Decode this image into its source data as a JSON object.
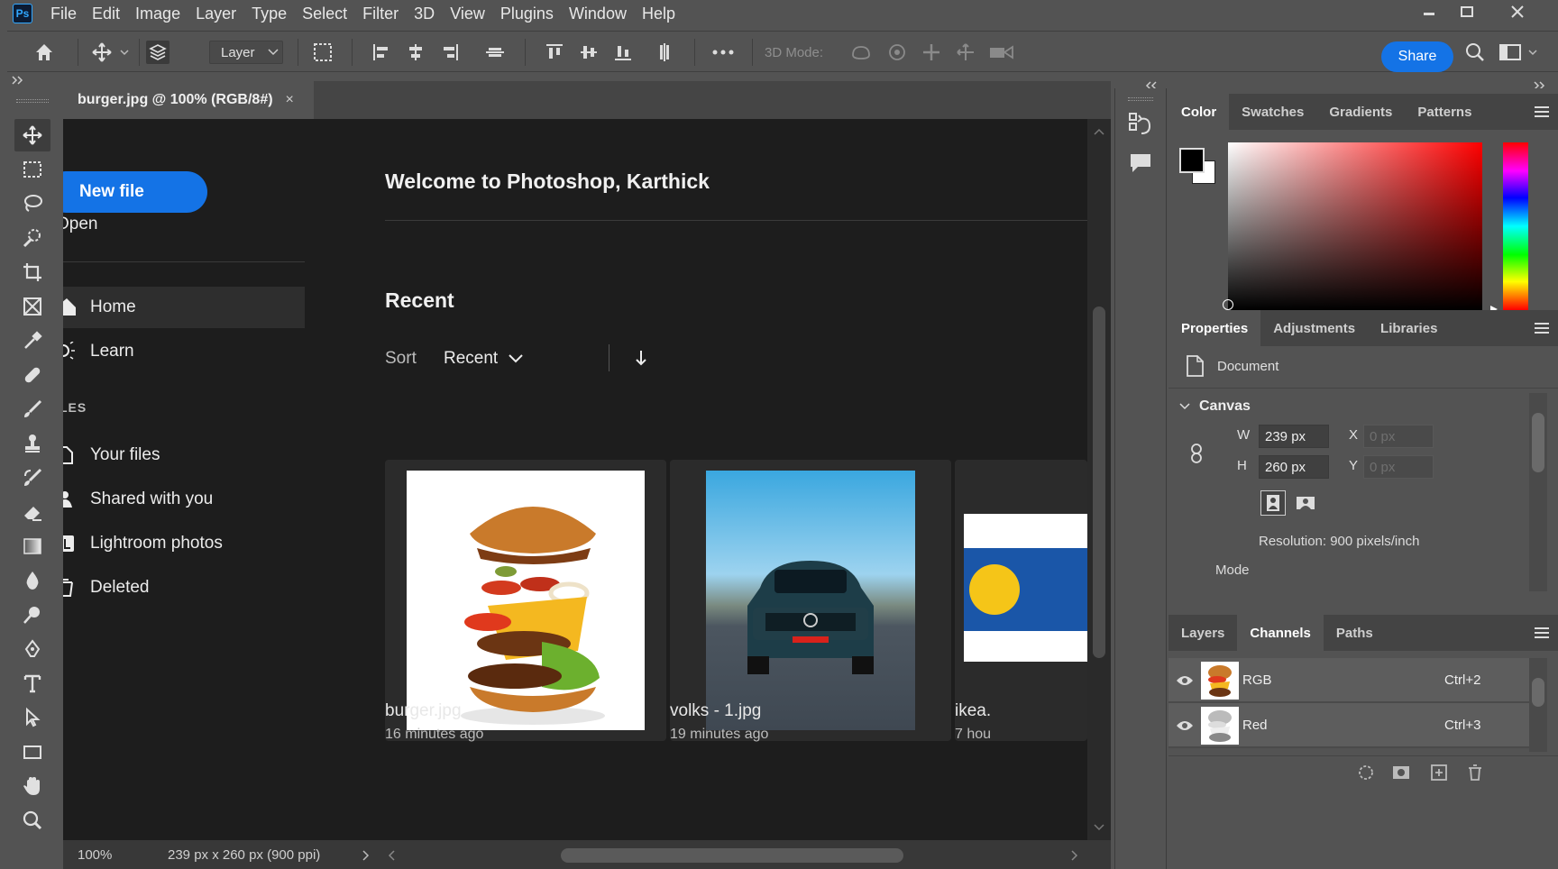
{
  "app": {
    "logo": "Ps"
  },
  "menu": [
    "File",
    "Edit",
    "Image",
    "Layer",
    "Type",
    "Select",
    "Filter",
    "3D",
    "View",
    "Plugins",
    "Window",
    "Help"
  ],
  "options_bar": {
    "layer_select": "Layer",
    "mode_3d_label": "3D Mode:",
    "share_label": "Share"
  },
  "document_tab": {
    "title": "burger.jpg @ 100% (RGB/8#)",
    "close": "×"
  },
  "home": {
    "new_file": "New file",
    "open": "Open",
    "welcome": "Welcome to Photoshop, Karthick",
    "nav": [
      {
        "label": "Home"
      },
      {
        "label": "Learn"
      }
    ],
    "files_header": "LES",
    "files_nav": [
      {
        "label": "Your files"
      },
      {
        "label": "Shared with you"
      },
      {
        "label": "Lightroom photos"
      },
      {
        "label": "Deleted"
      }
    ],
    "recent_title": "Recent",
    "sort_label": "Sort",
    "sort_value": "Recent",
    "recent_files": [
      {
        "name": "burger.jpg",
        "time": "16 minutes ago"
      },
      {
        "name": "volks - 1.jpg",
        "time": "19 minutes ago"
      },
      {
        "name": "ikea.",
        "time": "7 hou"
      }
    ]
  },
  "status_bar": {
    "zoom": "100%",
    "info": "239 px x 260 px (900 ppi)"
  },
  "color_panel": {
    "tabs": [
      "Color",
      "Swatches",
      "Gradients",
      "Patterns"
    ],
    "foreground": "#000000",
    "background": "#ffffff"
  },
  "properties_panel": {
    "tabs": [
      "Properties",
      "Adjustments",
      "Libraries"
    ],
    "document_label": "Document",
    "canvas_section": "Canvas",
    "w_label": "W",
    "w_value": "239 px",
    "h_label": "H",
    "h_value": "260 px",
    "x_label": "X",
    "x_placeholder": "0 px",
    "y_label": "Y",
    "y_placeholder": "0 px",
    "resolution": "Resolution: 900 pixels/inch",
    "mode_label": "Mode"
  },
  "channels_panel": {
    "tabs": [
      "Layers",
      "Channels",
      "Paths"
    ],
    "channels": [
      {
        "name": "RGB",
        "shortcut": "Ctrl+2"
      },
      {
        "name": "Red",
        "shortcut": "Ctrl+3"
      }
    ]
  },
  "colors": {
    "accent": "#1473e6",
    "panel": "#535353",
    "home_bg": "#1d1d1d"
  }
}
